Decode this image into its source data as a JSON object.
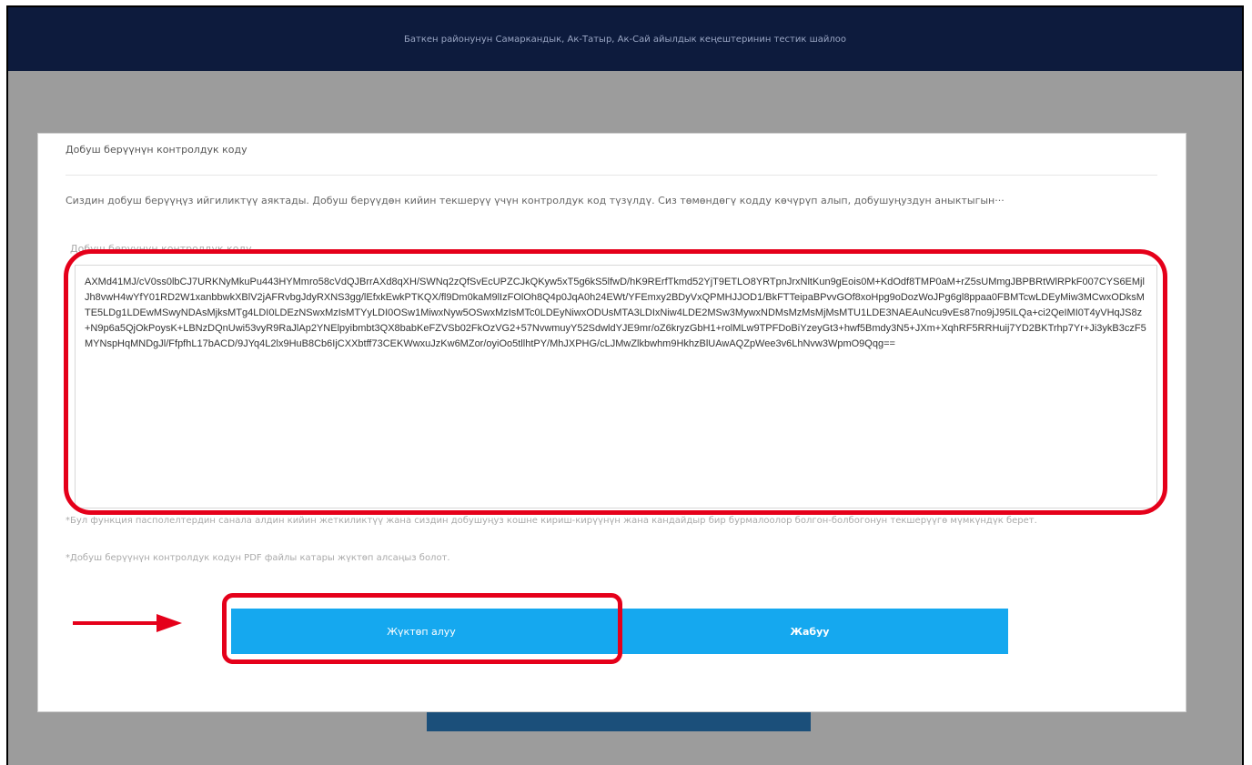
{
  "header": {
    "title": "Баткен районунун Самаркандык, Ак-Татыр, Ак-Сай айылдык кеңештеринин тестик шайлоо"
  },
  "modal": {
    "title": "Добуш берүүнүн контролдук коду",
    "description": "Сиздин добуш берүүңүз ийгиликтүү аяктады. Добуш берүүдөн кийин текшерүү үчүн контролдук код түзүлдү. Сиз төмөндөгү кодду көчүрүп алып, добушуңуздун аныктыгын···",
    "field_label": "Добуш берүүнүн контролдук коду",
    "control_code": "AXMd41MJ/cV0ss0lbCJ7URKNyMkuPu443HYMmro58cVdQJBrrAXd8qXH/SWNq2zQfSvEcUPZCJkQKyw5xT5g6kS5lfwD/hK9RErfTkmd52YjT9ETLO8YRTpnJrxNltKun9gEois0M+KdOdf8TMP0aM+rZ5sUMmgJBPBRtWlRPkF007CYS6EMjlJh8vwH4wYfY01RD2W1xanbbwkXBlV2jAFRvbgJdyRXNS3gg/lEfxkEwkPTKQX/fl9Dm0kaM9lIzFOlOh8Q4p0JqA0h24EWt/YFEmxy2BDyVxQPMHJJOD1/BkFTTeipaBPvvGOf8xoHpg9oDozWoJPg6gl8ppaa0FBMTcwLDEyMiw3MCwxODksMTE5LDg1LDEwMSwyNDAsMjksMTg4LDI0LDEzNSwxMzIsMTYyLDI0OSw1MiwxNyw5OSwxMzIsMTc0LDEyNiwxODUsMTA3LDIxNiw4LDE2MSw3MywxNDMsMzMsMjMsMTU1LDE3NAEAuNcu9vEs87no9jJ95ILQa+ci2QeIMI0T4yVHqJS8z+N9p6a5QjOkPoysK+LBNzDQnUwi53vyR9RaJlAp2YNElpyibmbt3QX8babKeFZVSb02FkOzVG2+57NvwmuyY52SdwldYJE9mr/oZ6kryzGbH1+rolMLw9TPFDoBiYzeyGt3+hwf5Bmdy3N5+JXm+XqhRF5RRHuij7YD2BKTrhp7Yr+Ji3ykB3czF5MYNspHqMNDgJl/FfpfhL17bACD/9JYq4L2lx9HuB8Cb6IjCXXbtff73CEKWwxuJzKw6MZor/oyiOo5tllhtPY/MhJXPHG/cLJMwZlkbwhm9HkhzBlUAwAQZpWee3v6LhNvw3WpmO9Qqg==",
    "note_1": "*Бул функция пасполелтердин санала алдин кийин жеткиликтүү жана сиздин добушуңуз кошне кириш-кирүүнүн жана кандайдыр бир бурмалоолор болгон-болбогонун текшерүүгө мүмкүндүк берет.",
    "note_2": "*Добуш берүүнүн контролдук кодун PDF файлы катары жүктөп алсаңыз болот.",
    "download_label": "Жүктөп алуу",
    "close_label": "Жабуу"
  },
  "colors": {
    "header_bg": "#0d1b3d",
    "button_bg": "#15a8ef",
    "highlight": "#e5001a",
    "backdrop": "#9c9c9c"
  }
}
